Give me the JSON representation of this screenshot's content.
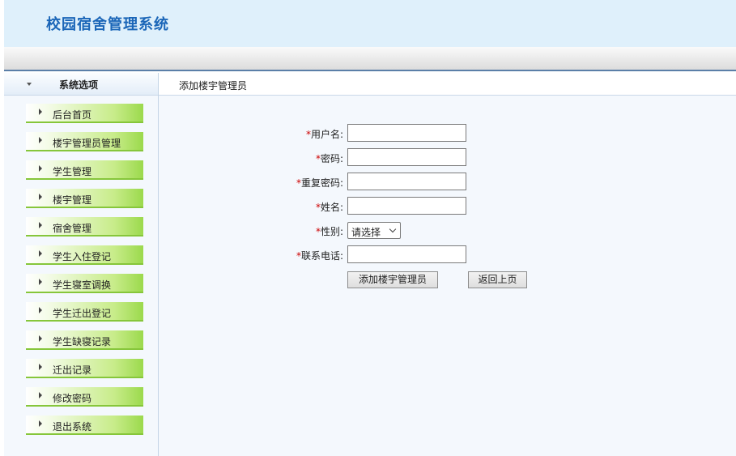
{
  "app": {
    "title": "校园宿舍管理系统"
  },
  "sidebar": {
    "header": "系统选项",
    "items": [
      {
        "label": "后台首页"
      },
      {
        "label": "楼宇管理员管理"
      },
      {
        "label": "学生管理"
      },
      {
        "label": "楼宇管理"
      },
      {
        "label": "宿舍管理"
      },
      {
        "label": "学生入住登记"
      },
      {
        "label": "学生寝室调换"
      },
      {
        "label": "学生迁出登记"
      },
      {
        "label": "学生缺寝记录"
      },
      {
        "label": "迁出记录"
      },
      {
        "label": "修改密码"
      },
      {
        "label": "退出系统"
      }
    ]
  },
  "main": {
    "breadcrumb": "添加楼宇管理员",
    "required_mark": "*",
    "form": {
      "username_label": "用户名:",
      "password_label": "密码:",
      "confirm_password_label": "重复密码:",
      "name_label": "姓名:",
      "gender_label": "性别:",
      "gender_selected": "请选择",
      "phone_label": "联系电话:"
    },
    "buttons": {
      "submit": "添加楼宇管理员",
      "back": "返回上页"
    }
  },
  "colors": {
    "title": "#1b66b8",
    "header_bg": "#dff0fb",
    "menu_green": "#9bd94c",
    "required": "#cc0000"
  }
}
